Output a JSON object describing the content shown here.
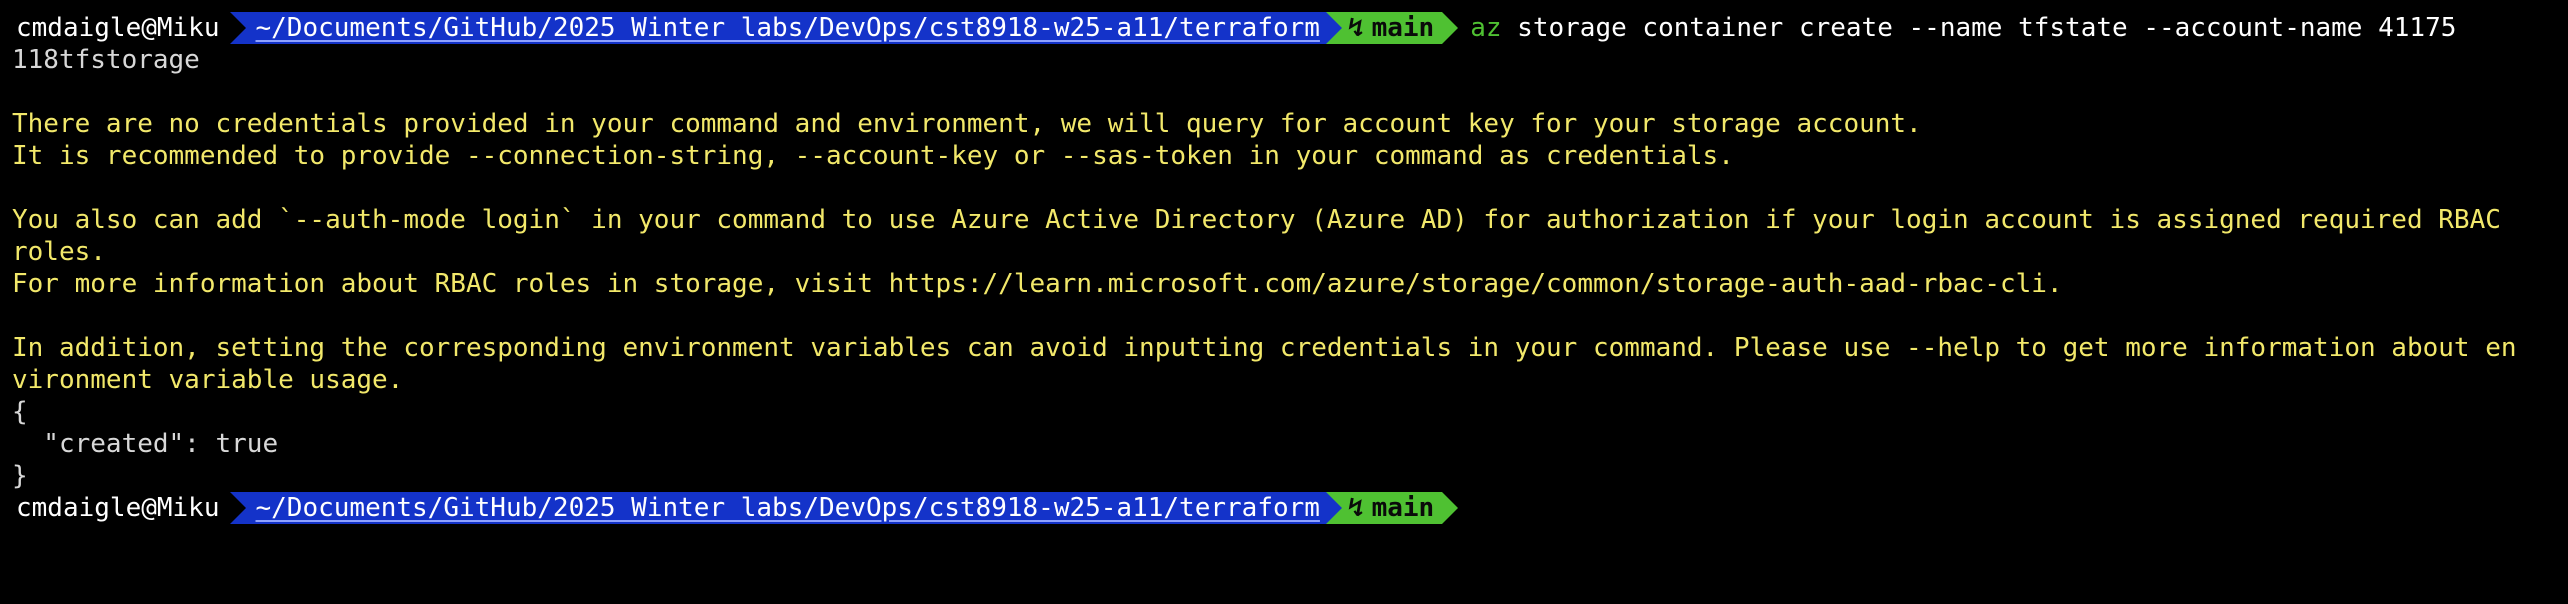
{
  "prompt": {
    "user_host": "cmdaigle@Miku",
    "path": "~/Documents/GitHub/2025 Winter labs/DevOps/cst8918-w25-a11/terraform",
    "git_icon_glyph": "↯",
    "git_branch": "main"
  },
  "command": {
    "program": "az",
    "args": " storage container create --name tfstate --account-name 41175",
    "wrap": "118tfstorage"
  },
  "output": {
    "warning_lines": [
      "There are no credentials provided in your command and environment, we will query for account key for your storage account.",
      "It is recommended to provide --connection-string, --account-key or --sas-token in your command as credentials.",
      "",
      "You also can add `--auth-mode login` in your command to use Azure Active Directory (Azure AD) for authorization if your login account is assigned required RBAC",
      "roles.",
      "For more information about RBAC roles in storage, visit https://learn.microsoft.com/azure/storage/common/storage-auth-aad-rbac-cli.",
      "",
      "In addition, setting the corresponding environment variables can avoid inputting credentials in your command. Please use --help to get more information about en",
      "vironment variable usage."
    ],
    "json_lines": [
      "{",
      "  \"created\": true",
      "}"
    ]
  },
  "colors": {
    "background": "#000000",
    "path_segment": "#1433c9",
    "git_segment": "#4fc132",
    "warning_text": "#f2e86a"
  },
  "icons": {
    "git_branch": "git-branch-icon"
  }
}
